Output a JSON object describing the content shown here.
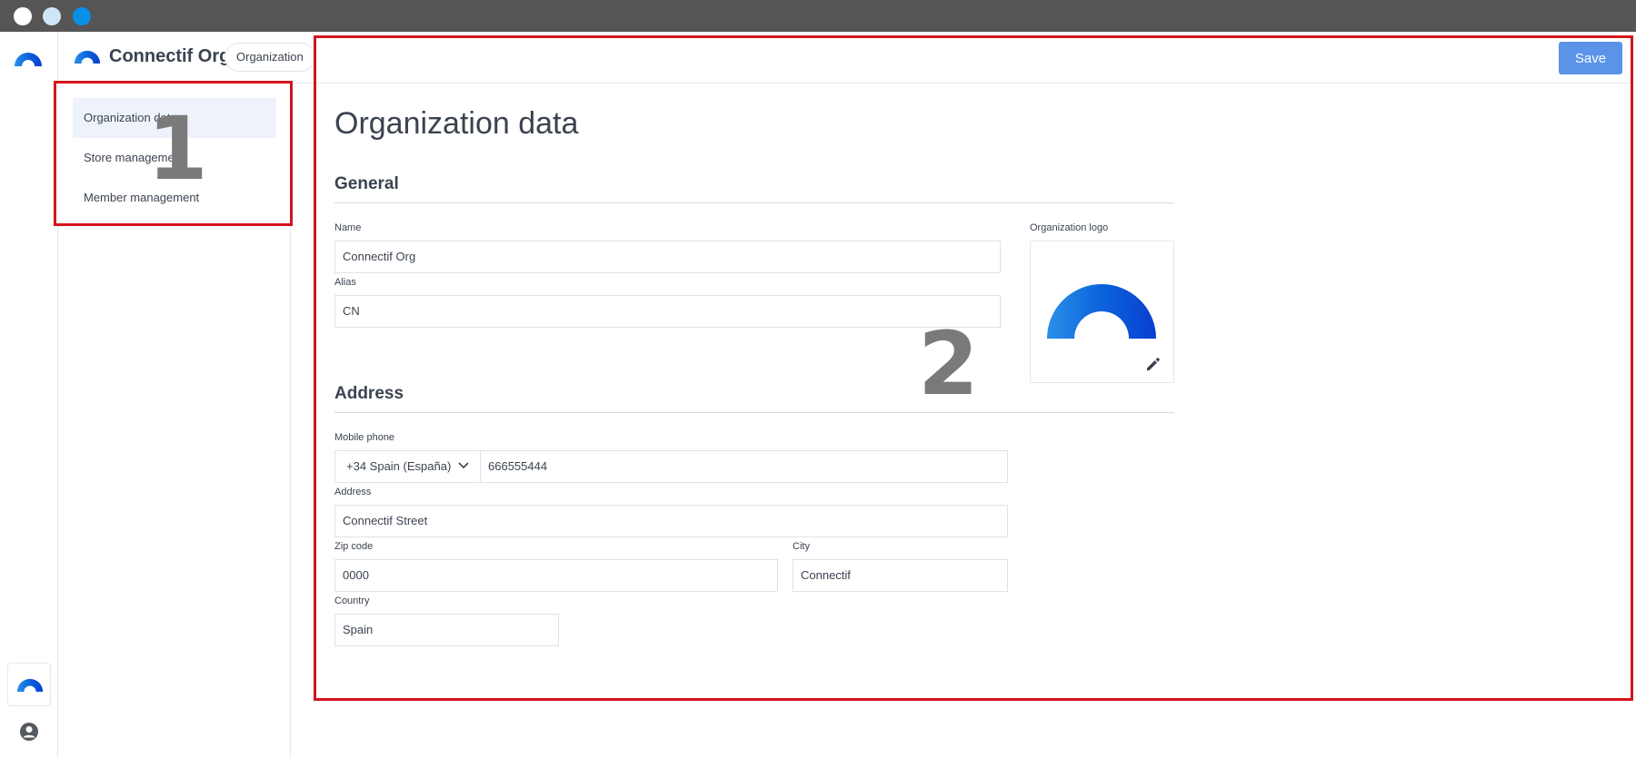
{
  "window": {
    "controls": [
      "close",
      "minimize",
      "maximize"
    ]
  },
  "header": {
    "org_name": "Connectif Org",
    "section_chip": "Organization",
    "save_label": "Save"
  },
  "subnav": {
    "items": [
      {
        "label": "Organization data",
        "active": true
      },
      {
        "label": "Store management",
        "active": false
      },
      {
        "label": "Member management",
        "active": false
      }
    ]
  },
  "main": {
    "page_title": "Organization data",
    "general": {
      "title": "General",
      "name_label": "Name",
      "name_value": "Connectif Org",
      "alias_label": "Alias",
      "alias_value": "CN",
      "logo_label": "Organization logo"
    },
    "address": {
      "title": "Address",
      "mobile_label": "Mobile phone",
      "country_code": "+34 Spain (España)",
      "phone_value": "666555444",
      "address_label": "Address",
      "address_value": "Connectif Street",
      "zip_label": "Zip code",
      "zip_value": "0000",
      "city_label": "City",
      "city_value": "Connectif",
      "country_label": "Country",
      "country_value": "Spain"
    }
  },
  "annotations": {
    "box1_number": "1",
    "box2_number": "2",
    "color": "#d3141c"
  },
  "icons": {
    "brand": "connectif-arc-logo",
    "user": "user-circle-icon",
    "edit": "pencil-icon",
    "dropdown": "chevron-down-icon"
  },
  "colors": {
    "accent": "#5b93e8",
    "brand_blue": "#0b5fd8",
    "active_nav": "#eef3fb"
  }
}
